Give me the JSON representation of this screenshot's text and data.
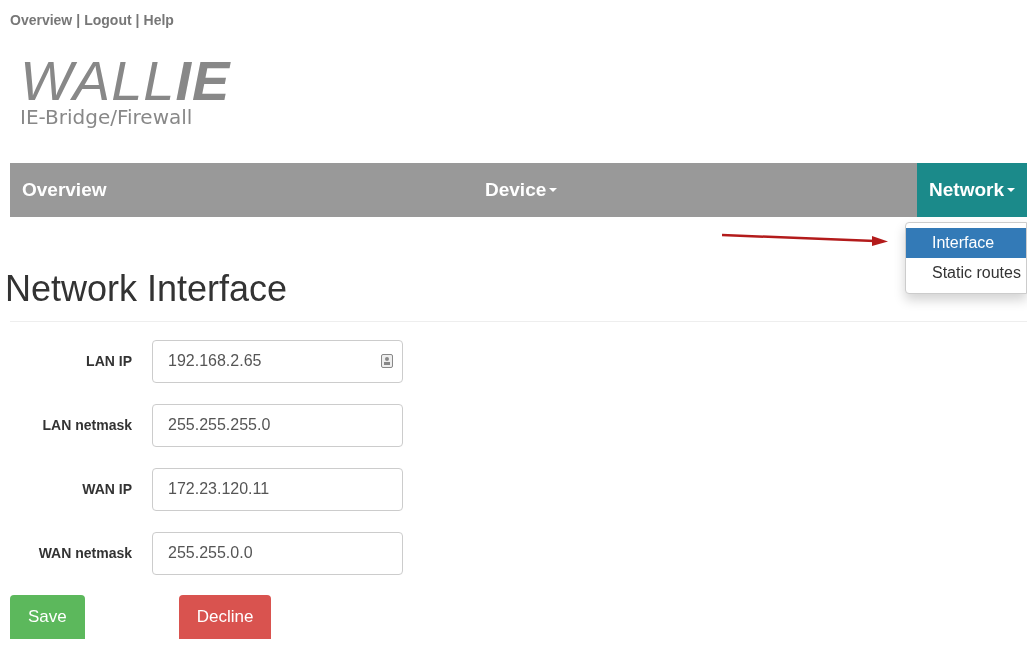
{
  "top_links": [
    "Overview",
    "Logout",
    "Help"
  ],
  "top_link_separator": "|",
  "logo": {
    "light": "WALL",
    "bold": "IE",
    "subtitle": "IE-Bridge/Firewall"
  },
  "nav": [
    {
      "label": "Overview",
      "dropdown": false,
      "selected": false
    },
    {
      "label": "Device",
      "dropdown": true,
      "selected": false
    },
    {
      "label": "Network",
      "dropdown": true,
      "selected": true
    }
  ],
  "dropdown_menu": [
    {
      "label": "Interface",
      "selected": true
    },
    {
      "label": "Static routes",
      "selected": false
    }
  ],
  "heading": "Network Interface",
  "fields": [
    {
      "label": "LAN IP",
      "value": "192.168.2.65",
      "autofill_icon": true
    },
    {
      "label": "LAN netmask",
      "value": "255.255.255.0",
      "autofill_icon": false
    },
    {
      "label": "WAN IP",
      "value": "172.23.120.11",
      "autofill_icon": false
    },
    {
      "label": "WAN netmask",
      "value": "255.255.0.0",
      "autofill_icon": false
    }
  ],
  "buttons": [
    {
      "label": "Save",
      "kind": "success"
    },
    {
      "label": "Decline",
      "kind": "danger"
    }
  ]
}
